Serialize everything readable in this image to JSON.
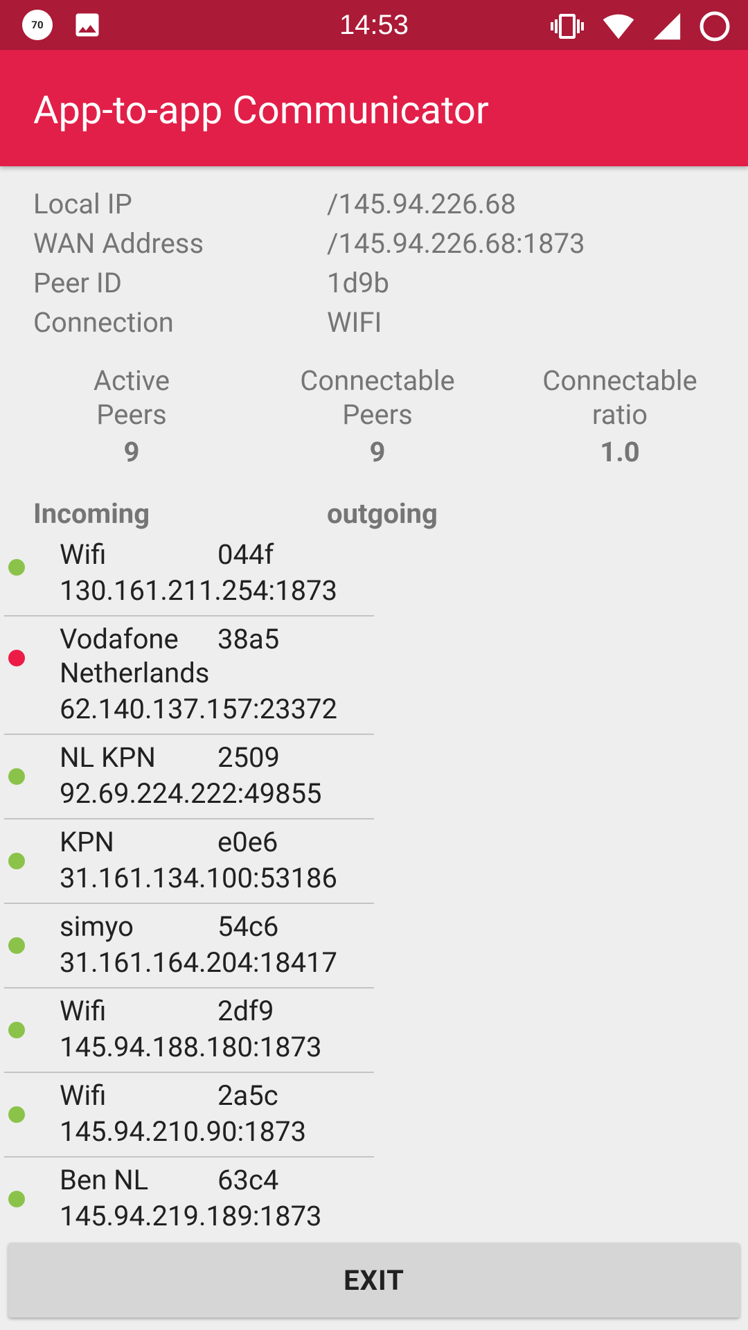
{
  "status_bar": {
    "time": "14:53",
    "notification_badge": "70",
    "icons": [
      "speed-badge-icon",
      "image-icon",
      "vibrate-icon",
      "wifi-icon",
      "signal-icon",
      "battery-icon"
    ]
  },
  "app_bar": {
    "title": "App-to-app Communicator"
  },
  "info": [
    {
      "label": "Local IP",
      "value": "/145.94.226.68"
    },
    {
      "label": "WAN Address",
      "value": "/145.94.226.68:1873"
    },
    {
      "label": "Peer ID",
      "value": "1d9b"
    },
    {
      "label": "Connection",
      "value": "WIFI"
    }
  ],
  "stats": {
    "active": {
      "label_line1": "Active",
      "label_line2": "Peers",
      "value": "9"
    },
    "connectable": {
      "label_line1": "Connectable",
      "label_line2": "Peers",
      "value": "9"
    },
    "ratio": {
      "label_line1": "Connectable",
      "label_line2": "ratio",
      "value": "1.0"
    }
  },
  "headers": {
    "incoming": "Incoming",
    "outgoing": "outgoing"
  },
  "peers": [
    {
      "name": "Wifi",
      "id": "044f",
      "address": "130.161.211.254:1873",
      "status_color": "#8bc34a"
    },
    {
      "name": "Vodafone Netherlands",
      "name_line1": "Vodafone",
      "name_line2": "Netherlands",
      "id": "38a5",
      "address": "62.140.137.157:23372",
      "status_color": "#ec1c47"
    },
    {
      "name": "NL KPN",
      "id": "2509",
      "address": "92.69.224.222:49855",
      "status_color": "#8bc34a"
    },
    {
      "name": "KPN",
      "id": "e0e6",
      "address": "31.161.134.100:53186",
      "status_color": "#8bc34a"
    },
    {
      "name": "simyo",
      "id": "54c6",
      "address": "31.161.164.204:18417",
      "status_color": "#8bc34a"
    },
    {
      "name": "Wifi",
      "id": "2df9",
      "address": "145.94.188.180:1873",
      "status_color": "#8bc34a"
    },
    {
      "name": "Wifi",
      "id": "2a5c",
      "address": "145.94.210.90:1873",
      "status_color": "#8bc34a"
    },
    {
      "name": "Ben NL",
      "id": "63c4",
      "address": "145.94.219.189:1873",
      "status_color": "#8bc34a"
    }
  ],
  "exit_label": "EXIT",
  "colors": {
    "status_bar": "#ab1a37",
    "app_bar": "#e21f48",
    "background": "#eeeeee",
    "online": "#8bc34a",
    "offline": "#ec1c47"
  }
}
